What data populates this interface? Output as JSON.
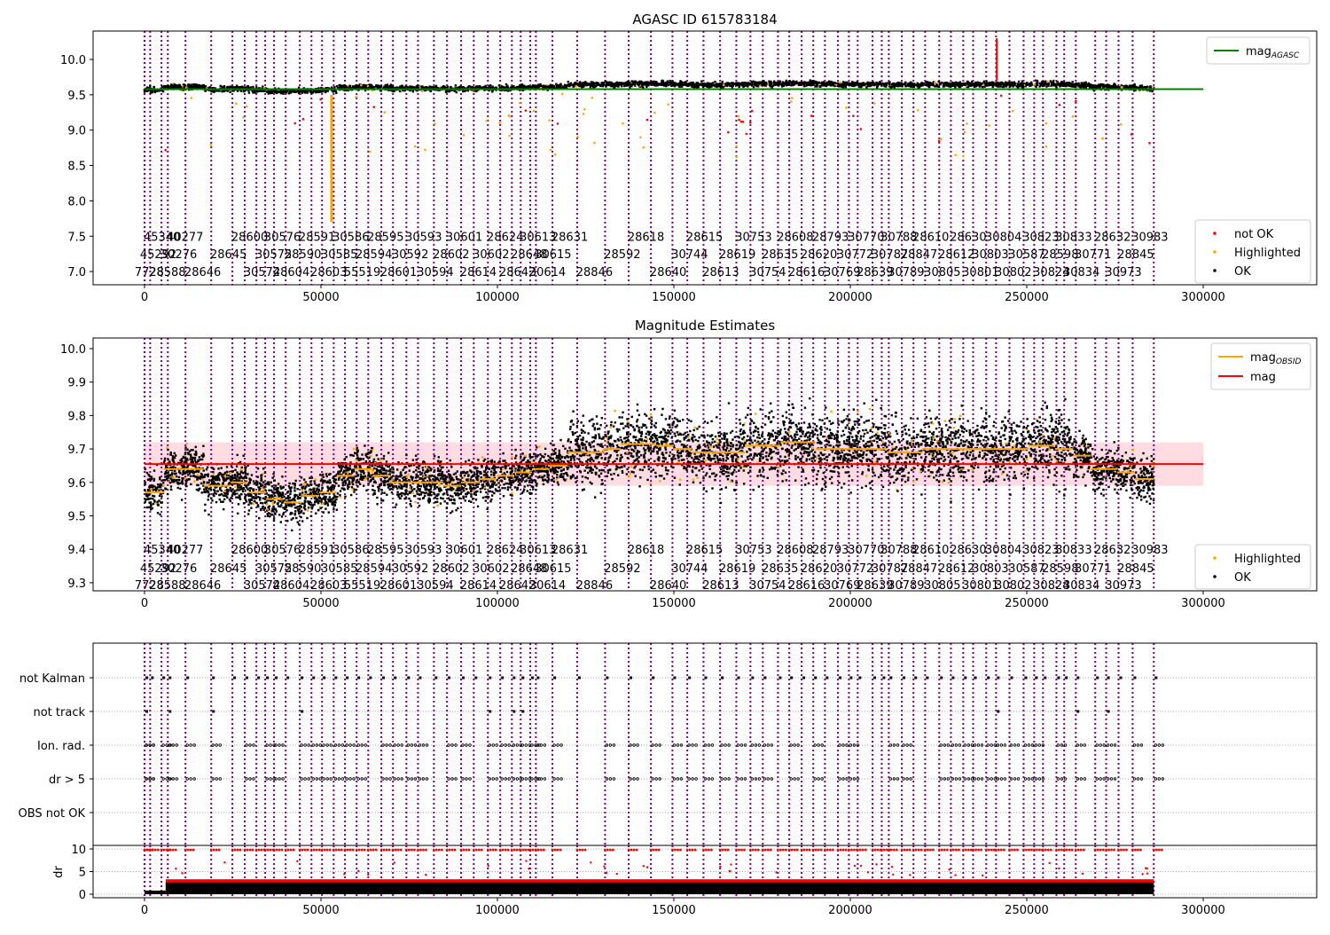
{
  "chart_data": [
    {
      "type": "scatter",
      "title": "AGASC ID 615783184",
      "xlim": [
        -14600,
        331000
      ],
      "ylim": [
        6.81,
        10.4
      ],
      "xticks": [
        0,
        50000,
        100000,
        150000,
        200000,
        250000,
        300000
      ],
      "yticks": [
        "7.0",
        "7.5",
        "8.0",
        "8.5",
        "9.0",
        "9.5",
        "10.0"
      ],
      "mag_agasc": 9.58,
      "legend_lines": [
        {
          "label": "mag",
          "sub": "AGASC",
          "color": "#008000"
        }
      ],
      "legend_points": [
        {
          "label": "not OK",
          "color": "#ff0000"
        },
        {
          "label": "Highlighted",
          "color": "#ffa500"
        },
        {
          "label": "OK",
          "color": "#000000"
        }
      ]
    },
    {
      "type": "scatter",
      "title": "Magnitude Estimates",
      "xlim": [
        -14600,
        331000
      ],
      "ylim": [
        9.276,
        10.03
      ],
      "xticks": [
        0,
        50000,
        100000,
        150000,
        200000,
        250000,
        300000
      ],
      "yticks": [
        "9.3",
        "9.4",
        "9.5",
        "9.6",
        "9.7",
        "9.8",
        "9.9",
        "10.0"
      ],
      "mag": 9.655,
      "mag_band": [
        9.59,
        9.72
      ],
      "legend_lines": [
        {
          "label": "mag",
          "sub": "OBSID",
          "color": "#ffa500"
        },
        {
          "label": "mag",
          "sub": "",
          "color": "#ff0000"
        }
      ],
      "legend_points": [
        {
          "label": "Highlighted",
          "color": "#ffa500"
        },
        {
          "label": "OK",
          "color": "#000000"
        }
      ],
      "mag_obsid_profile": [
        [
          0,
          9.57
        ],
        [
          5500,
          9.64
        ],
        [
          11800,
          9.64
        ],
        [
          16800,
          9.59
        ],
        [
          24400,
          9.6
        ],
        [
          29400,
          9.57
        ],
        [
          34400,
          9.55
        ],
        [
          39400,
          9.54
        ],
        [
          44500,
          9.56
        ],
        [
          49500,
          9.57
        ],
        [
          54500,
          9.62
        ],
        [
          59500,
          9.64
        ],
        [
          64600,
          9.62
        ],
        [
          69600,
          9.6
        ],
        [
          74600,
          9.6
        ],
        [
          79600,
          9.6
        ],
        [
          84700,
          9.59
        ],
        [
          89700,
          9.6
        ],
        [
          94700,
          9.61
        ],
        [
          99800,
          9.62
        ],
        [
          104800,
          9.63
        ],
        [
          109800,
          9.64
        ],
        [
          114800,
          9.65
        ],
        [
          119900,
          9.69
        ],
        [
          129900,
          9.7
        ],
        [
          134900,
          9.715
        ],
        [
          145000,
          9.71
        ],
        [
          150000,
          9.7
        ],
        [
          155000,
          9.69
        ],
        [
          160100,
          9.69
        ],
        [
          170100,
          9.71
        ],
        [
          180200,
          9.72
        ],
        [
          190200,
          9.7
        ],
        [
          200300,
          9.7
        ],
        [
          210300,
          9.69
        ],
        [
          220400,
          9.7
        ],
        [
          230400,
          9.7
        ],
        [
          240500,
          9.7
        ],
        [
          250500,
          9.71
        ],
        [
          258000,
          9.7
        ],
        [
          263100,
          9.68
        ],
        [
          268100,
          9.64
        ],
        [
          275600,
          9.63
        ],
        [
          280700,
          9.61
        ],
        [
          285700,
          9.61
        ]
      ]
    },
    {
      "type": "scatter",
      "title": "",
      "flag_rows": [
        "not Kalman",
        "not track",
        "Ion. rad.",
        "dr > 5",
        "OBS not OK"
      ],
      "dr_ylabel": "dr",
      "dr_yticks": [
        "0",
        "5",
        "10"
      ],
      "xticks": [
        0,
        50000,
        100000,
        150000,
        200000,
        250000,
        300000
      ]
    }
  ],
  "obsid_labels": [
    [
      [
        "45340",
        -250
      ],
      [
        "40277",
        6300
      ],
      [
        "28600",
        24600
      ],
      [
        "30576",
        33900
      ],
      [
        "28591",
        43700
      ],
      [
        "30586",
        53300
      ],
      [
        "28595",
        63100
      ],
      [
        "30593",
        73900
      ],
      [
        "30601",
        85400
      ],
      [
        "28624",
        97000
      ],
      [
        "30613",
        106300
      ],
      [
        "28631",
        115300
      ],
      [
        "28618",
        136900
      ],
      [
        "28615",
        153500
      ],
      [
        "30753",
        167400
      ],
      [
        "28608",
        179200
      ],
      [
        "28793",
        189200
      ],
      [
        "30770",
        199300
      ],
      [
        "30788",
        208600
      ],
      [
        "28610",
        217600
      ],
      [
        "28630",
        228200
      ],
      [
        "30804",
        238200
      ],
      [
        "30823",
        248800
      ],
      [
        "30833",
        258100
      ],
      [
        "28632",
        269100
      ],
      [
        "30983",
        279700
      ]
    ],
    [
      [
        "45292",
        -1300
      ],
      [
        "30276",
        4500
      ],
      [
        "28645",
        18600
      ],
      [
        "30575",
        31400
      ],
      [
        "28590",
        39700
      ],
      [
        "30585",
        50000
      ],
      [
        "28594",
        59800
      ],
      [
        "30592",
        70100
      ],
      [
        "28602",
        81700
      ],
      [
        "30602",
        93000
      ],
      [
        "28648",
        103800
      ],
      [
        "30615",
        110600
      ],
      [
        "28592",
        130200
      ],
      [
        "30744",
        149300
      ],
      [
        "28619",
        162800
      ],
      [
        "28635",
        174900
      ],
      [
        "28620",
        185900
      ],
      [
        "30772",
        196200
      ],
      [
        "30787",
        206000
      ],
      [
        "28847",
        214300
      ],
      [
        "28612",
        224900
      ],
      [
        "30803",
        234500
      ],
      [
        "30587",
        244800
      ],
      [
        "28598",
        254300
      ],
      [
        "30771",
        263600
      ],
      [
        "28845",
        275700
      ]
    ],
    [
      [
        "7728",
        -2800
      ],
      [
        "28588",
        1300
      ],
      [
        "28646",
        11300
      ],
      [
        "30574",
        28100
      ],
      [
        "28604",
        36400
      ],
      [
        "28603",
        47000
      ],
      [
        "55519",
        56500
      ],
      [
        "28601",
        66800
      ],
      [
        "30594",
        77200
      ],
      [
        "28614",
        89400
      ],
      [
        "28642",
        100500
      ],
      [
        "30614",
        109000
      ],
      [
        "28846",
        122300
      ],
      [
        "28640",
        143200
      ],
      [
        "28613",
        158100
      ],
      [
        "30754",
        171400
      ],
      [
        "28616",
        182400
      ],
      [
        "30769",
        192500
      ],
      [
        "28639",
        201800
      ],
      [
        "30789",
        210600
      ],
      [
        "30805",
        220900
      ],
      [
        "30801",
        231700
      ],
      [
        "30802",
        241000
      ],
      [
        "30824",
        251800
      ],
      [
        "30834",
        260300
      ],
      [
        "30973",
        272200
      ]
    ]
  ],
  "colors": {
    "ok": "#000000",
    "highlighted": "#ffa500",
    "not_ok": "#ff0000",
    "agasc": "#008000",
    "obsid_line": "#800080",
    "band": "#ffc0cb"
  }
}
